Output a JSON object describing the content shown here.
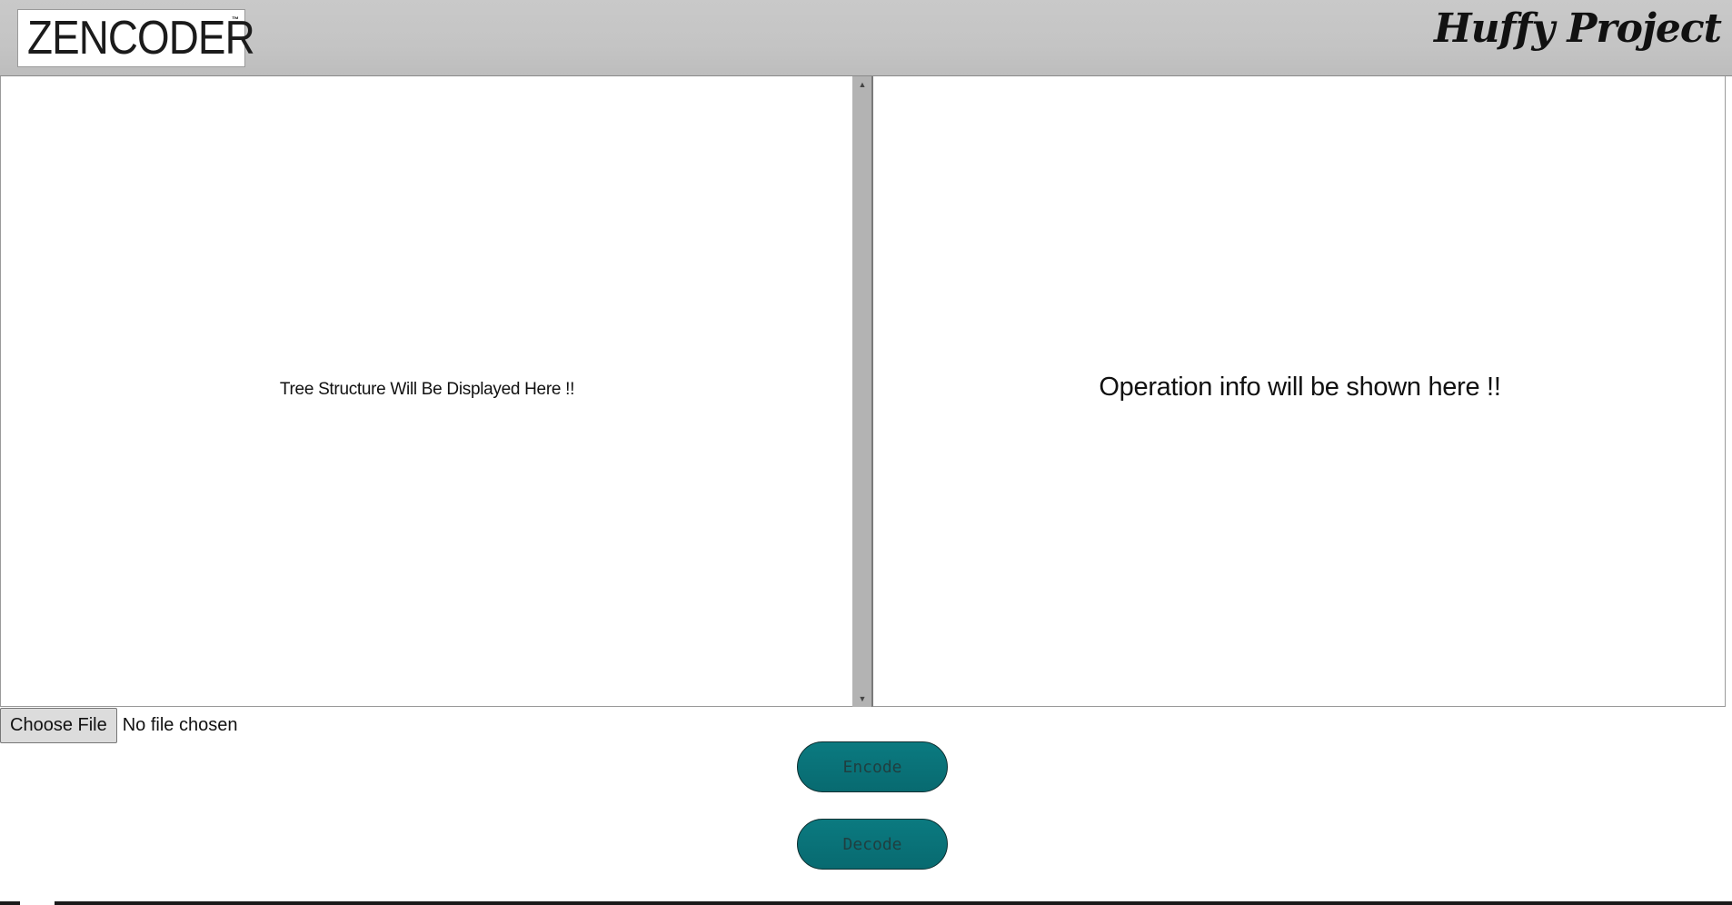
{
  "header": {
    "logo_text": "ZENCODER",
    "logo_tm": "™",
    "project_title": "Huffy Project"
  },
  "left_panel": {
    "message": "Tree Structure Will Be Displayed Here !!"
  },
  "scrollbar": {
    "up_icon": "▲",
    "down_icon": "▼"
  },
  "right_panel": {
    "message": "Operation info will be shown here !!"
  },
  "file_input": {
    "button_label": "Choose File",
    "status": "No file chosen"
  },
  "actions": {
    "encode_label": "Encode",
    "decode_label": "Decode"
  },
  "colors": {
    "header_bg": "#c7c7c7",
    "button_teal": "#0b7a80"
  }
}
